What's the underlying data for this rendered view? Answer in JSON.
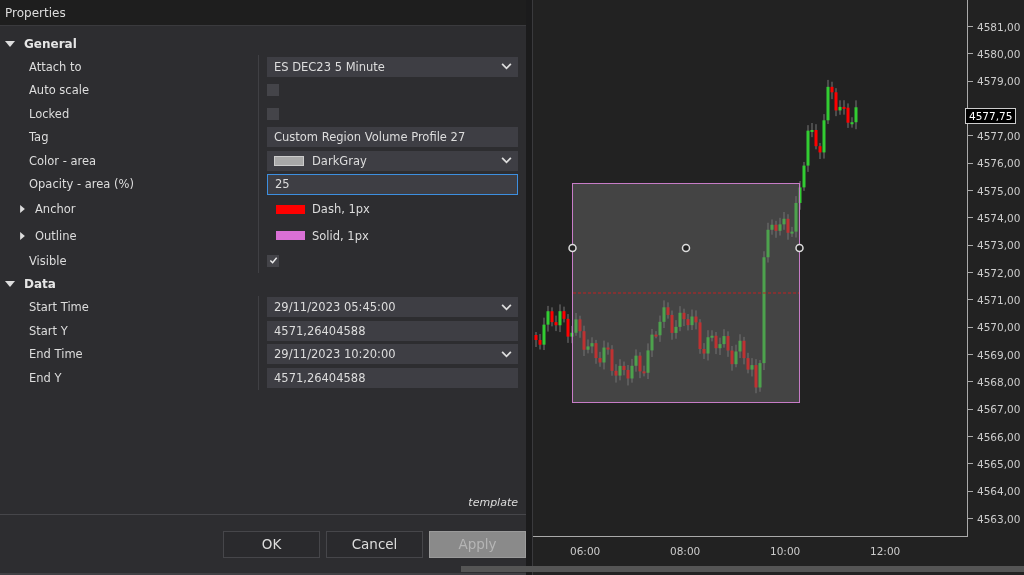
{
  "window": {
    "title": "Properties"
  },
  "sections": [
    {
      "label": "General",
      "expanded": true,
      "rows": [
        {
          "kind": "dropdown",
          "label": "Attach to",
          "value": "ES DEC23 5 Minute"
        },
        {
          "kind": "checkbox",
          "label": "Auto scale",
          "checked": false
        },
        {
          "kind": "checkbox",
          "label": "Locked",
          "checked": false
        },
        {
          "kind": "text",
          "label": "Tag",
          "value": "Custom Region Volume Profile 27"
        },
        {
          "kind": "color",
          "label": "Color - area",
          "value": "DarkGray",
          "color": "#a9a9a9"
        },
        {
          "kind": "input",
          "label": "Opacity - area (%)",
          "value": "25",
          "focused": true
        },
        {
          "kind": "stroke",
          "label": "Anchor",
          "expanded": false,
          "value": "Dash, 1px",
          "color": "#ff0000"
        },
        {
          "kind": "stroke",
          "label": "Outline",
          "expanded": false,
          "value": "Solid, 1px",
          "color": "#da70d6"
        },
        {
          "kind": "checkbox",
          "label": "Visible",
          "checked": true
        }
      ]
    },
    {
      "label": "Data",
      "expanded": true,
      "rows": [
        {
          "kind": "dropdown",
          "label": "Start Time",
          "value": "29/11/2023 05:45:00"
        },
        {
          "kind": "text",
          "label": "Start Y",
          "value": "4571,26404588"
        },
        {
          "kind": "dropdown",
          "label": "End Time",
          "value": "29/11/2023 10:20:00"
        },
        {
          "kind": "text",
          "label": "End Y",
          "value": "4571,26404588"
        }
      ]
    }
  ],
  "template_link": "template",
  "buttons": [
    {
      "label": "OK",
      "disabled": false
    },
    {
      "label": "Cancel",
      "disabled": false
    },
    {
      "label": "Apply",
      "disabled": true
    }
  ],
  "chart": {
    "price_axis": [
      {
        "kind": "tick",
        "label": "4581,00"
      },
      {
        "kind": "tick",
        "label": "4580,00"
      },
      {
        "kind": "tick",
        "label": "4579,00"
      },
      {
        "kind": "current",
        "label": "4577,75"
      },
      {
        "kind": "tick",
        "label": "4577,00"
      },
      {
        "kind": "tick",
        "label": "4576,00"
      },
      {
        "kind": "tick",
        "label": "4575,00"
      },
      {
        "kind": "tick",
        "label": "4574,00"
      },
      {
        "kind": "tick",
        "label": "4573,00"
      },
      {
        "kind": "tick",
        "label": "4572,00"
      },
      {
        "kind": "tick",
        "label": "4571,00"
      },
      {
        "kind": "tick",
        "label": "4570,00"
      },
      {
        "kind": "tick",
        "label": "4569,00"
      },
      {
        "kind": "tick",
        "label": "4568,00"
      },
      {
        "kind": "tick",
        "label": "4567,00"
      },
      {
        "kind": "tick",
        "label": "4566,00"
      },
      {
        "kind": "tick",
        "label": "4565,00"
      },
      {
        "kind": "tick",
        "label": "4564,00"
      },
      {
        "kind": "tick",
        "label": "4563,00"
      }
    ],
    "time_axis": [
      "06:00",
      "08:00",
      "10:00",
      "12:00"
    ]
  }
}
